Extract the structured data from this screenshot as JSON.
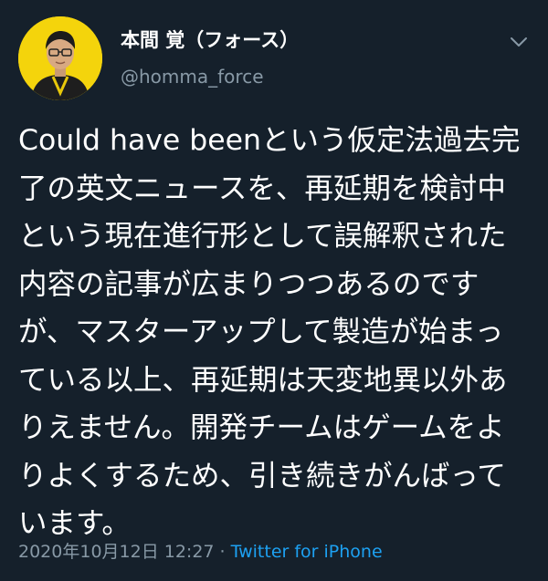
{
  "author": {
    "display_name": "本間 覚（フォース）",
    "handle": "@homma_force"
  },
  "tweet": {
    "text": "Could have beenという仮定法過去完了の英文ニュースを、再延期を検討中という現在進行形として誤解釈された内容の記事が広まりつつあるのですが、マスターアップして製造が始まっている以上、再延期は天変地異以外ありえません。開発チームはゲームをよりよくするため、引き続きがんばっています。",
    "timestamp": "2020年10月12日 12:27",
    "separator": " · ",
    "source": "Twitter for iPhone"
  },
  "icons": {
    "menu": "chevron-down-icon"
  },
  "colors": {
    "background": "#15202b",
    "text_primary": "#ffffff",
    "text_secondary": "#8899a6",
    "link": "#1da1f2",
    "avatar_bg": "#f4d40c"
  }
}
